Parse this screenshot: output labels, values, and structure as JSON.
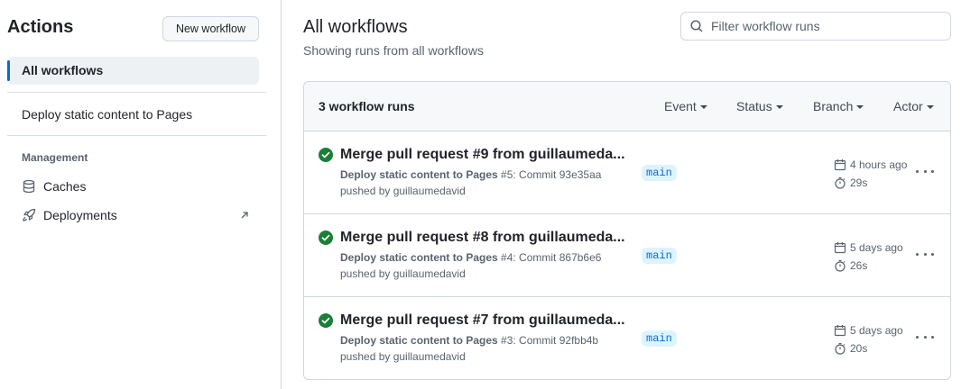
{
  "sidebar": {
    "title": "Actions",
    "new_workflow_label": "New workflow",
    "all_workflows_label": "All workflows",
    "workflow_link": "Deploy static content to Pages",
    "management_heading": "Management",
    "caches_label": "Caches",
    "deployments_label": "Deployments"
  },
  "main": {
    "title": "All workflows",
    "subtitle": "Showing runs from all workflows",
    "filter_placeholder": "Filter workflow runs",
    "runs_count": "3 workflow runs",
    "filters": [
      "Event",
      "Status",
      "Branch",
      "Actor"
    ],
    "runs": [
      {
        "title": "Merge pull request #9 from guillaumeda...",
        "workflow": "Deploy static content to Pages",
        "meta_rest": " #5: Commit 93e35aa",
        "pushed_by": "pushed by guillaumedavid",
        "branch": "main",
        "when": "4 hours ago",
        "duration": "29s"
      },
      {
        "title": "Merge pull request #8 from guillaumeda...",
        "workflow": "Deploy static content to Pages",
        "meta_rest": " #4: Commit 867b6e6",
        "pushed_by": "pushed by guillaumedavid",
        "branch": "main",
        "when": "5 days ago",
        "duration": "26s"
      },
      {
        "title": "Merge pull request #7 from guillaumeda...",
        "workflow": "Deploy static content to Pages",
        "meta_rest": " #3: Commit 92fbb4b",
        "pushed_by": "pushed by guillaumedavid",
        "branch": "main",
        "when": "5 days ago",
        "duration": "20s"
      }
    ]
  },
  "colors": {
    "accent": "#0969da",
    "success": "#1a7f37",
    "border": "#d0d7de",
    "muted_text": "#59636e"
  }
}
